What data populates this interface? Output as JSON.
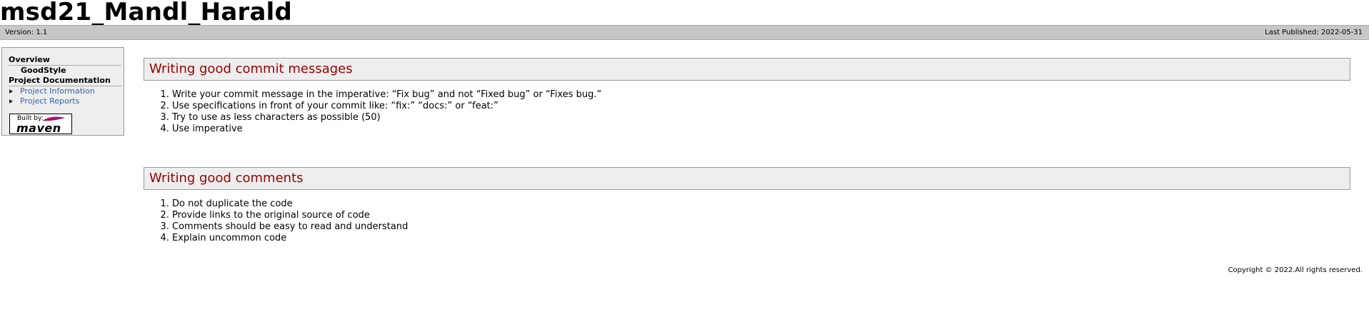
{
  "banner": {
    "title": "msd21_Mandl_Harald"
  },
  "breadcrumbs": {
    "version": "Version: 1.1",
    "last_published": "Last Published: 2022-05-31"
  },
  "navigation": {
    "overview_heading": "Overview",
    "overview_items": [
      "GoodStyle"
    ],
    "project_documentation_heading": "Project Documentation",
    "project_documentation_items": [
      "Project Information",
      "Project Reports"
    ],
    "powered_by": {
      "built_by": "Built by:",
      "logo_text": "maven"
    }
  },
  "sections": [
    {
      "heading": "Writing good commit messages",
      "items": [
        "Write your commit message in the imperative: “Fix bug” and not “Fixed bug” or “Fixes bug.”",
        "Use specifications in front of your commit like: “fix:” “docs:” or “feat:”",
        "Try to use as less characters as possible (50)",
        "Use imperative"
      ]
    },
    {
      "heading": "Writing good comments",
      "items": [
        "Do not duplicate the code",
        "Provide links to the original source of code",
        "Comments should be easy to read and understand",
        "Explain uncommon code"
      ]
    }
  ],
  "footer": {
    "copyright": "Copyright © 2022.All rights reserved."
  },
  "colors": {
    "heading_text": "#990000",
    "link": "#3366aa",
    "breadcrumb_bg": "#c7c7c7",
    "section_bg": "#eeeeee"
  }
}
